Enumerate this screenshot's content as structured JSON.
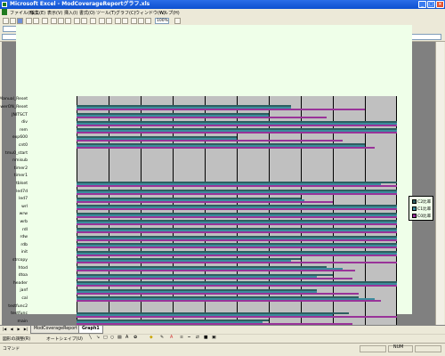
{
  "window": {
    "title": "Microsoft Excel - ModCoverageReportグラフ.xls"
  },
  "menu": [
    "ファイル(F)",
    "編集(E)",
    "表示(V)",
    "挿入(I)",
    "書式(O)",
    "ツール(T)",
    "グラフ(C)",
    "ウィンドウ(W)",
    "ヘルプ(H)"
  ],
  "toolbar": {
    "zoom": "100%"
  },
  "sheet_tabs": [
    "ModCoverageReport",
    "Graph1"
  ],
  "draw_toolbar": {
    "draw_label": "図形の調整(R)",
    "autoshape_label": "オートシェイプ(U)"
  },
  "status": {
    "left": "コマンド",
    "right": "NUM"
  },
  "colors": {
    "c2": "#2e5e60",
    "c1": "#3b8c9c",
    "c0": "#993399",
    "plot_bg": "#c0c0c0",
    "chart_bg": "#efffe9"
  },
  "chart_data": {
    "type": "bar",
    "orientation": "horizontal",
    "xlim": [
      0,
      100
    ],
    "xticks": [
      "0",
      "10",
      "20",
      "30",
      "40",
      "50",
      "60",
      "70",
      "80",
      "90",
      "100"
    ],
    "grid": true,
    "legend_position": "right",
    "categories": [
      "Manual_Reset",
      "PowerON_Reset",
      "JNITSCT",
      "div",
      "rem",
      "exp600",
      "cnt0",
      "tmu0_start",
      "nmisub",
      "timer2",
      "timer1",
      "tblset",
      "led7d",
      "led7",
      "wrl",
      "wrw",
      "wrb",
      "rdl",
      "rdw",
      "rdb",
      "init",
      "strcopy",
      "htod",
      "dtoa",
      "header",
      "janf",
      "cal",
      "testfunc2",
      "testfunc",
      "main"
    ],
    "series": [
      {
        "name": "C2比率",
        "values": [
          0,
          67,
          60,
          100,
          100,
          50,
          90,
          0,
          0,
          0,
          0,
          100,
          100,
          70,
          100,
          100,
          100,
          100,
          100,
          100,
          100,
          70,
          78,
          80,
          100,
          75,
          88,
          0,
          85,
          60
        ]
      },
      {
        "name": "C1比率",
        "values": [
          0,
          67,
          60,
          100,
          100,
          50,
          90,
          0,
          0,
          0,
          0,
          95,
          100,
          71,
          100,
          100,
          100,
          100,
          100,
          100,
          100,
          67,
          83,
          75,
          100,
          75,
          93,
          0,
          80,
          58
        ]
      },
      {
        "name": "C0比率",
        "values": [
          0,
          90,
          78,
          100,
          100,
          83,
          93,
          0,
          0,
          0,
          0,
          100,
          100,
          80,
          100,
          100,
          100,
          100,
          100,
          100,
          100,
          100,
          87,
          86,
          100,
          88,
          95,
          0,
          100,
          86
        ]
      }
    ]
  }
}
